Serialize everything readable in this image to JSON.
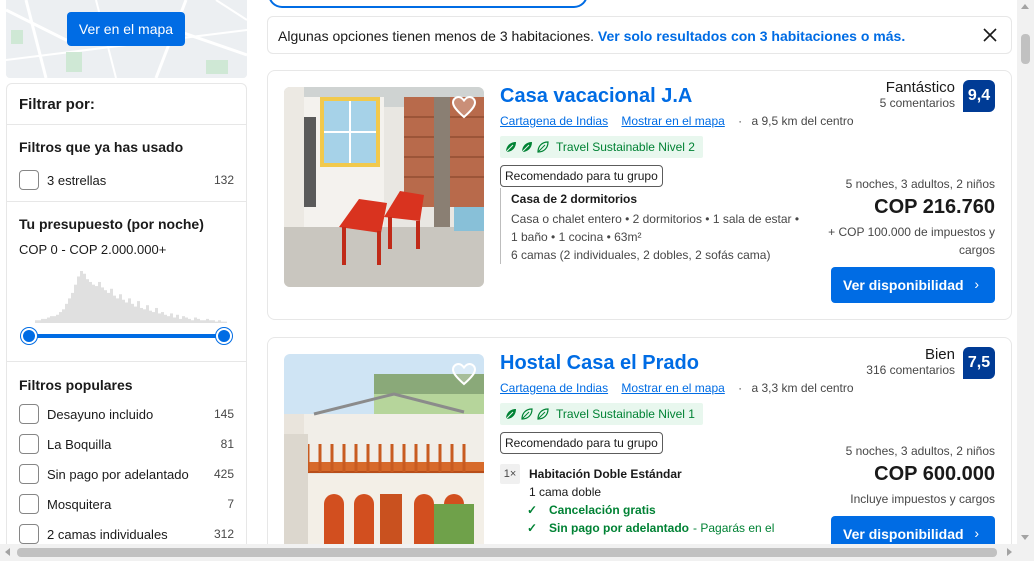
{
  "map": {
    "button_label": "Ver en el mapa"
  },
  "filters": {
    "title": "Filtrar por:",
    "used": {
      "heading": "Filtros que ya has usado",
      "items": [
        {
          "label": "3 estrellas",
          "count": "132"
        }
      ]
    },
    "budget": {
      "heading": "Tu presupuesto (por noche)",
      "range": "COP 0 - COP 2.000.000+",
      "histogram": [
        2,
        2,
        3,
        3,
        4,
        5,
        5,
        6,
        8,
        10,
        14,
        18,
        22,
        28,
        34,
        38,
        36,
        32,
        30,
        28,
        27,
        30,
        26,
        24,
        22,
        25,
        20,
        18,
        21,
        17,
        15,
        18,
        14,
        12,
        16,
        11,
        10,
        13,
        9,
        8,
        11,
        7,
        8,
        6,
        5,
        7,
        4,
        6,
        3,
        5,
        4,
        3,
        2,
        4,
        3,
        2,
        2,
        3,
        2,
        2,
        1,
        2,
        1,
        1
      ]
    },
    "popular": {
      "heading": "Filtros populares",
      "items": [
        {
          "label": "Desayuno incluido",
          "count": "145"
        },
        {
          "label": "La Boquilla",
          "count": "81"
        },
        {
          "label": "Sin pago por adelantado",
          "count": "425"
        },
        {
          "label": "Mosquitera",
          "count": "7"
        },
        {
          "label": "2 camas individuales",
          "count": "312"
        }
      ]
    }
  },
  "notice": {
    "text": "Algunas opciones tienen menos de 3 habitaciones.",
    "link": "Ver solo resultados con 3 habitaciones o más."
  },
  "listings": [
    {
      "name": "Casa vacacional J.A",
      "city": "Cartagena de Indias",
      "map_link": "Mostrar en el mapa",
      "distance": "a 9,5 km del centro",
      "sustainable": "Travel Sustainable Nivel 2",
      "sustainable_level": 2,
      "recommended": "Recomendado para tu grupo",
      "unit_title": "Casa de 2 dormitorios",
      "unit_desc_1": "Casa o chalet entero • 2 dormitorios • 1 sala de estar •",
      "unit_desc_2": "1 baño • 1 cocina • 63m²",
      "unit_desc_3": "6 camas (2 individuales, 2 dobles, 2 sofás cama)",
      "rating_word": "Fantástico",
      "reviews": "5 comentarios",
      "score": "9,4",
      "stay": "5 noches, 3 adultos, 2 niños",
      "price": "COP 216.760",
      "tax": "+ COP 100.000 de impuestos y cargos",
      "cta": "Ver disponibilidad"
    },
    {
      "name": "Hostal Casa el Prado",
      "city": "Cartagena de Indias",
      "map_link": "Mostrar en el mapa",
      "distance": "a 3,3 km del centro",
      "sustainable": "Travel Sustainable Nivel 1",
      "sustainable_level": 1,
      "recommended": "Recomendado para tu grupo",
      "room_qty": "1×",
      "unit_title": "Habitación Doble Estándar",
      "unit_desc_1": "1 cama doble",
      "perk_1": "Cancelación gratis",
      "perk_2": "Sin pago por adelantado",
      "perk_2_sub": "- Pagarás en el",
      "rating_word": "Bien",
      "reviews": "316 comentarios",
      "score": "7,5",
      "stay": "5 noches, 3 adultos, 2 niños",
      "price": "COP 600.000",
      "tax": "Incluye impuestos y cargos",
      "cta": "Ver disponibilidad"
    }
  ]
}
